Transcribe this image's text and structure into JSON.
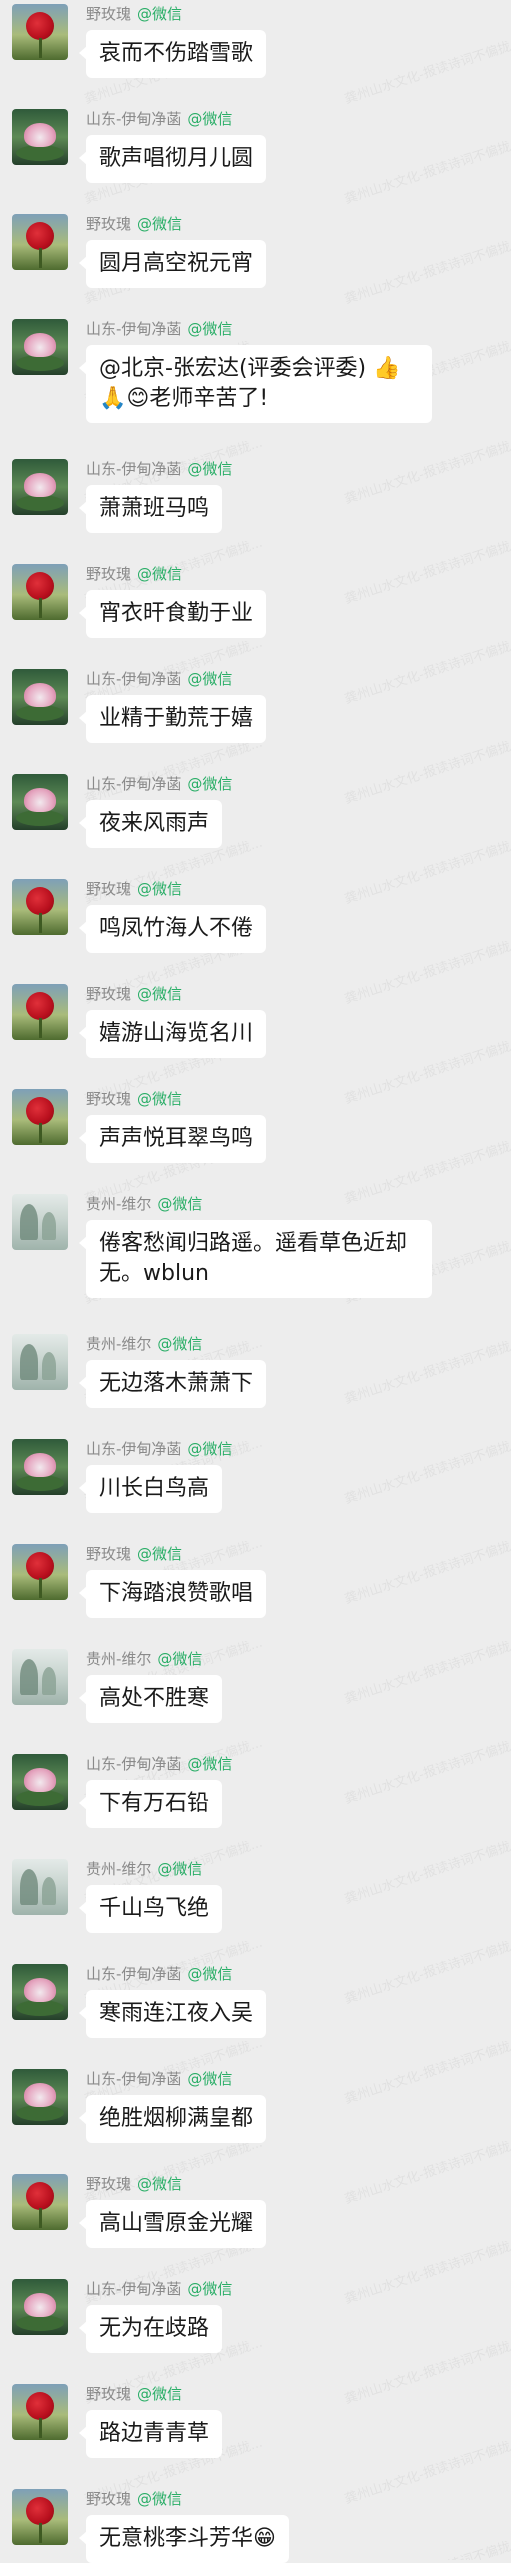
{
  "channel_tag": "@微信",
  "watermark_text": "龚州山水文化-报读诗词不偏拢...",
  "messages": [
    {
      "sender": "野玫瑰",
      "avatar": "rose",
      "text": "哀而不伤踏雪歌"
    },
    {
      "sender": "山东-伊甸净菡",
      "avatar": "lotus",
      "text": "歌声唱彻月儿圆"
    },
    {
      "sender": "野玫瑰",
      "avatar": "rose",
      "text": "圆月高空祝元宵"
    },
    {
      "sender": "山东-伊甸净菡",
      "avatar": "lotus",
      "text": "@北京-张宏达(评委会评委) 👍🙏😊老师辛苦了!",
      "multi": true
    },
    {
      "sender": "山东-伊甸净菡",
      "avatar": "lotus",
      "text": "萧萧班马鸣"
    },
    {
      "sender": "野玫瑰",
      "avatar": "rose",
      "text": "宵衣旰食勤于业"
    },
    {
      "sender": "山东-伊甸净菡",
      "avatar": "lotus",
      "text": "业精于勤荒于嬉"
    },
    {
      "sender": "山东-伊甸净菡",
      "avatar": "lotus",
      "text": "夜来风雨声"
    },
    {
      "sender": "野玫瑰",
      "avatar": "rose",
      "text": "鸣凤竹海人不倦"
    },
    {
      "sender": "野玫瑰",
      "avatar": "rose",
      "text": "嬉游山海览名川"
    },
    {
      "sender": "野玫瑰",
      "avatar": "rose",
      "text": "声声悦耳翠鸟鸣"
    },
    {
      "sender": "贵州-维尔",
      "avatar": "mist",
      "text": "倦客愁闻归路遥。遥看草色近却无。wblun",
      "multi": true
    },
    {
      "sender": "贵州-维尔",
      "avatar": "mist",
      "text": "无边落木萧萧下"
    },
    {
      "sender": "山东-伊甸净菡",
      "avatar": "lotus",
      "text": "川长白鸟高"
    },
    {
      "sender": "野玫瑰",
      "avatar": "rose",
      "text": "下海踏浪赞歌唱"
    },
    {
      "sender": "贵州-维尔",
      "avatar": "mist",
      "text": "高处不胜寒"
    },
    {
      "sender": "山东-伊甸净菡",
      "avatar": "lotus",
      "text": "下有万石铅"
    },
    {
      "sender": "贵州-维尔",
      "avatar": "mist",
      "text": "千山鸟飞绝"
    },
    {
      "sender": "山东-伊甸净菡",
      "avatar": "lotus",
      "text": "寒雨连江夜入吴"
    },
    {
      "sender": "山东-伊甸净菡",
      "avatar": "lotus",
      "text": "绝胜烟柳满皇都"
    },
    {
      "sender": "野玫瑰",
      "avatar": "rose",
      "text": "高山雪原金光耀"
    },
    {
      "sender": "山东-伊甸净菡",
      "avatar": "lotus",
      "text": "无为在歧路"
    },
    {
      "sender": "野玫瑰",
      "avatar": "rose",
      "text": "路边青青草"
    },
    {
      "sender": "野玫瑰",
      "avatar": "rose",
      "text": "无意桃李斗芳华😁"
    }
  ]
}
